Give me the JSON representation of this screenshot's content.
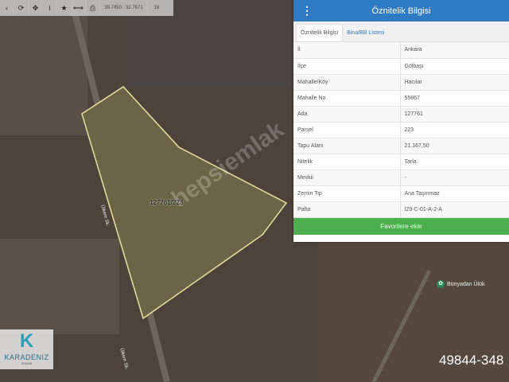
{
  "toolbar": {
    "buttons": [
      "chevron-icon",
      "refresh-icon",
      "move-icon",
      "info-icon",
      "star-icon",
      "measure-icon",
      "print-icon"
    ],
    "coords": "39.7450 : 32.7671",
    "zoom": "16"
  },
  "map": {
    "parcel_label": "127761/223",
    "street_1": "Ülkem Sk.",
    "street_2": "Ülkem Sk.",
    "poi": "Bünyadan Ülük",
    "watermark": "hepsiemlak",
    "listing_no": "49844-348",
    "logo": {
      "text": "KARADENIZ",
      "subtext": "EMLAK"
    }
  },
  "panel": {
    "title": "Öznitelik Bilgisi",
    "tabs": [
      "Öznitelik Bilgisi",
      "Bina/BB Listesi"
    ],
    "rows": [
      [
        "İl",
        "Ankara"
      ],
      [
        "İlçe",
        "Gölbaşı"
      ],
      [
        "Mahalle/Köy",
        "Hacılar"
      ],
      [
        "Mahalle No",
        "55867"
      ],
      [
        "Ada",
        "127761"
      ],
      [
        "Parsel",
        "223"
      ],
      [
        "Tapu Alanı",
        "21.167,50"
      ],
      [
        "Nitelik",
        "Tarla"
      ],
      [
        "Mevkii",
        "-"
      ],
      [
        "Zemin Tip",
        "Ana Taşınmaz"
      ],
      [
        "Pafta",
        "I29-C-01-A-2-A"
      ]
    ],
    "favorite_label": "Favorilere ekle"
  },
  "colors": {
    "header": "#2e7bc4",
    "button": "#4cae4c",
    "parcel_outline": "#e8e0a0"
  }
}
